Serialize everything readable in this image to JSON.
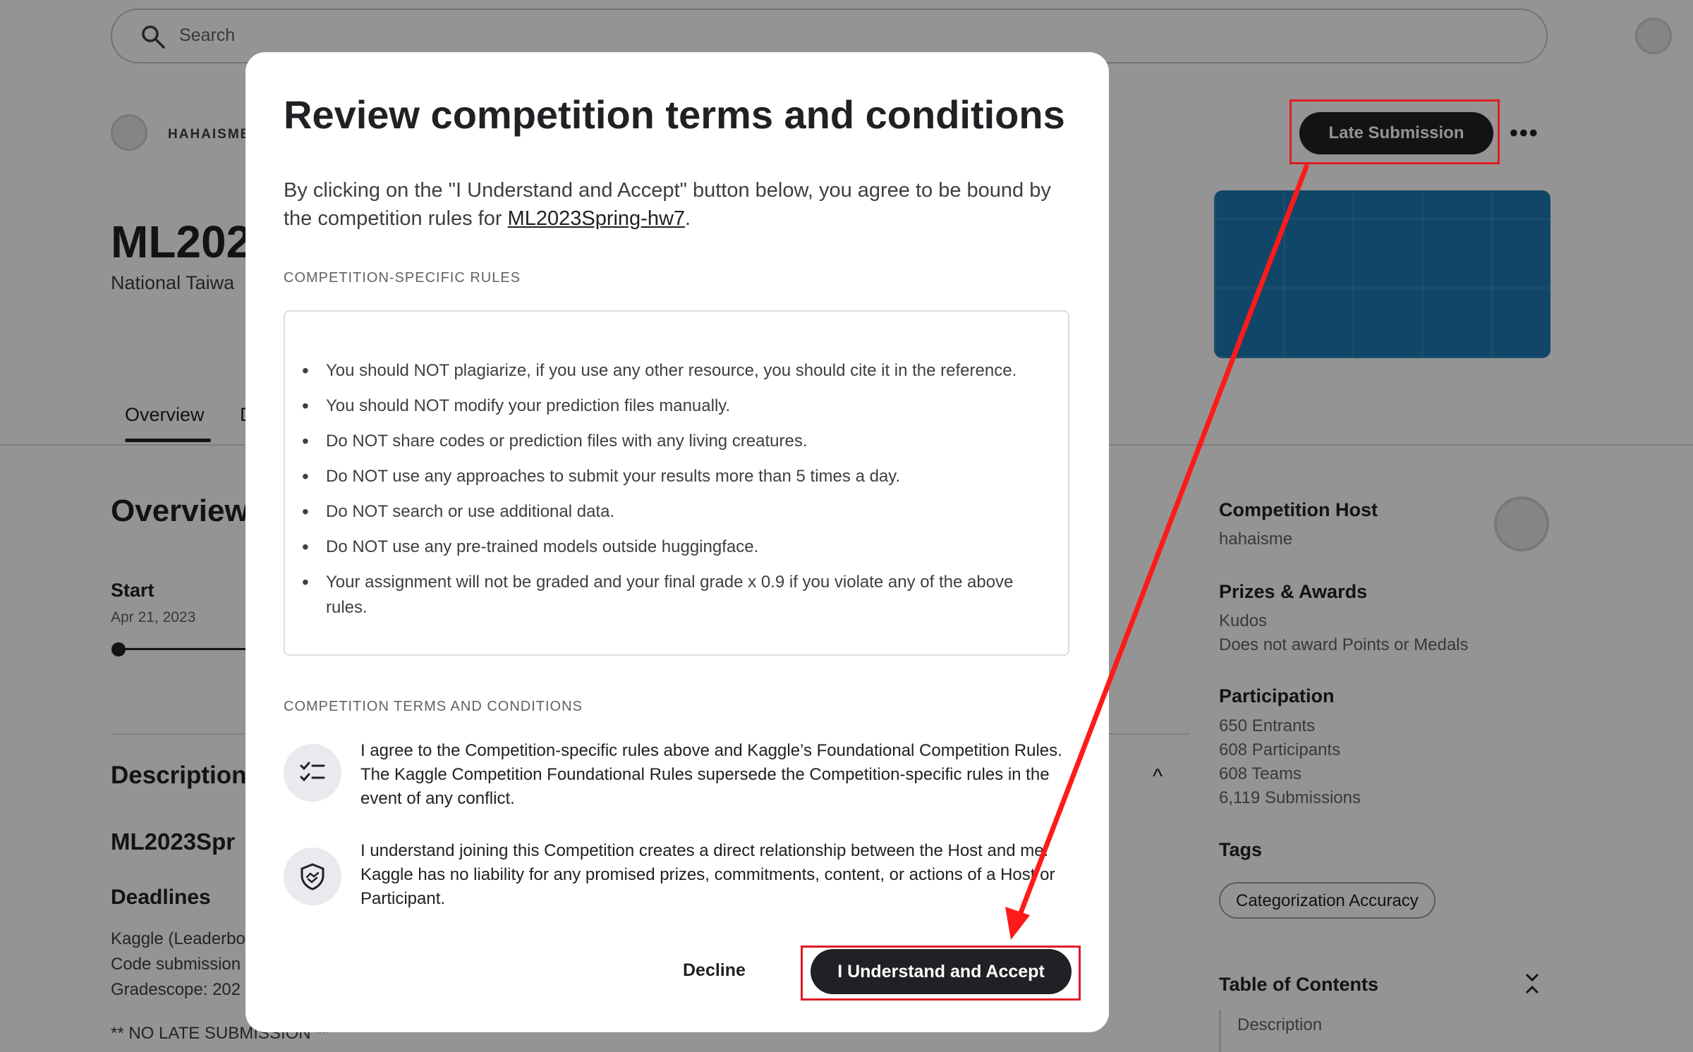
{
  "header": {
    "search_placeholder": "Search"
  },
  "competition": {
    "host_label": "HAHAISME",
    "title_visible": "ML202",
    "subtitle_visible": "National Taiwa",
    "late_submission_label": "Late Submission",
    "more_icon": "•••",
    "banner_color": "#1c7bb4"
  },
  "tabs": [
    {
      "label": "Overview"
    },
    {
      "label": "D"
    }
  ],
  "overview": {
    "heading": "Overview",
    "start_label": "Start",
    "start_date": "Apr 21, 2023",
    "description_heading": "Description",
    "ml_heading": "ML2023Spr",
    "deadlines_heading": "Deadlines",
    "deadline_lines": [
      "Kaggle (Leaderbo",
      "Code submission",
      "Gradescope: 202"
    ],
    "no_late": "** NO LATE SUBMISSION **",
    "collapse_icon": "^"
  },
  "sidebar": {
    "host_heading": "Competition Host",
    "host_name": "hahaisme",
    "prizes_heading": "Prizes & Awards",
    "prizes_lines": [
      "Kudos",
      "Does not award Points or Medals"
    ],
    "participation_heading": "Participation",
    "participation_lines": [
      "650 Entrants",
      "608 Participants",
      "608 Teams",
      "6,119 Submissions"
    ],
    "tags_heading": "Tags",
    "tag": "Categorization Accuracy",
    "toc_heading": "Table of Contents",
    "toc_item": "Description"
  },
  "modal": {
    "title": "Review competition terms and conditions",
    "intro_before": "By clicking on the \"I Understand and Accept\" button below, you agree to be bound by the competition rules for ",
    "intro_link": "ML2023Spring-hw7",
    "intro_after": ".",
    "section_rules": "COMPETITION-SPECIFIC RULES",
    "rules": [
      "You should NOT plagiarize, if you use any other resource, you should cite it in the reference.",
      "You should NOT modify your prediction files manually.",
      "Do NOT share codes or prediction files with any living creatures.",
      "Do NOT use any approaches to submit your results more than 5 times a day.",
      "Do NOT search or use additional data.",
      "Do NOT use any pre-trained models outside huggingface.",
      "Your assignment will not be graded and your final grade x 0.9 if you violate any of the above rules."
    ],
    "section_terms": "COMPETITION TERMS AND CONDITIONS",
    "term1": "I agree to the Competition-specific rules above and Kaggle’s Foundational Competition Rules. The Kaggle Competition Foundational Rules supersede the Competition-specific rules in the event of any conflict.",
    "term2": "I understand joining this Competition creates a direct relationship between the Host and me. Kaggle has no liability for any promised prizes, commitments, content, or actions of a Host or Participant.",
    "decline_label": "Decline",
    "accept_label": "I Understand and Accept"
  },
  "annotation": {
    "highlight_color": "#e01b24"
  }
}
